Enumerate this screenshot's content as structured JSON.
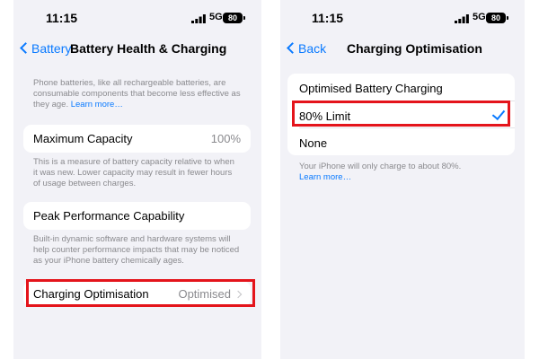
{
  "status_bar": {
    "time": "11:15",
    "network": "5G",
    "battery_level": "80"
  },
  "left_screen": {
    "nav": {
      "back_label": "Battery",
      "title": "Battery Health & Charging"
    },
    "intro_text": "Phone batteries, like all rechargeable batteries, are consumable components that become less effective as they age.",
    "intro_link": "Learn more…",
    "maximum_capacity": {
      "label": "Maximum Capacity",
      "value": "100%",
      "description": "This is a measure of battery capacity relative to when it was new. Lower capacity may result in fewer hours of usage between charges."
    },
    "peak_performance": {
      "label": "Peak Performance Capability",
      "description": "Built-in dynamic software and hardware systems will help counter performance impacts that may be noticed as your iPhone battery chemically ages."
    },
    "charging_optimisation": {
      "label": "Charging Optimisation",
      "value": "Optimised"
    }
  },
  "right_screen": {
    "nav": {
      "back_label": "Back",
      "title": "Charging Optimisation"
    },
    "options": [
      {
        "label": "Optimised Battery Charging",
        "selected": false
      },
      {
        "label": "80% Limit",
        "selected": true
      },
      {
        "label": "None",
        "selected": false
      }
    ],
    "footer_text": "Your iPhone will only charge to about 80%.",
    "footer_link": "Learn more…"
  },
  "colors": {
    "accent": "#0a7aff",
    "highlight": "#e4141b",
    "background": "#f2f2f7"
  }
}
